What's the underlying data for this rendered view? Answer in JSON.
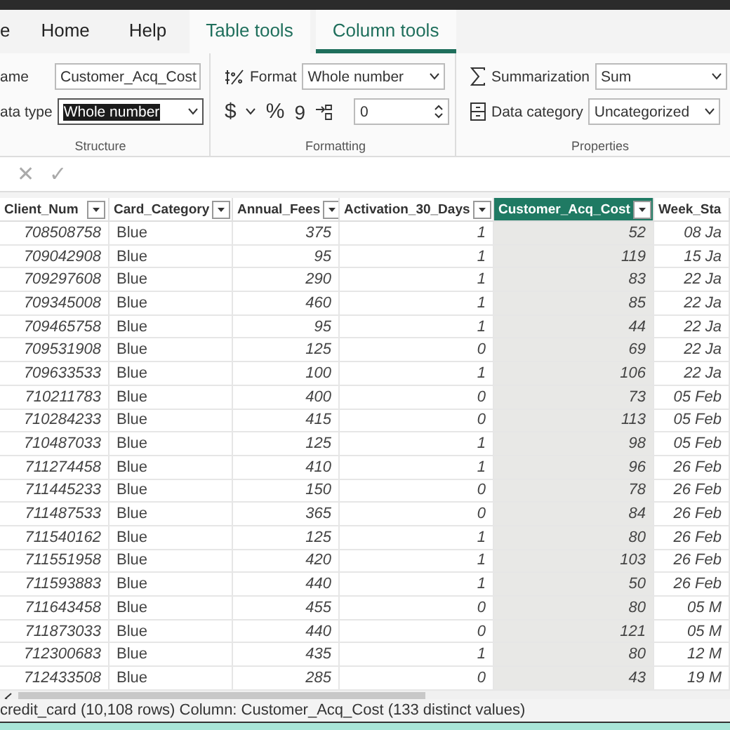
{
  "ribbon_tabs": [
    {
      "label": "e",
      "selected": false
    },
    {
      "label": "Home",
      "selected": false
    },
    {
      "label": "Help",
      "selected": false
    },
    {
      "label": "Table tools",
      "selected": false
    },
    {
      "label": "Column tools",
      "selected": true
    }
  ],
  "structure": {
    "name_label": "ame",
    "name_value": "Customer_Acq_Cost",
    "data_type_label": "ata type",
    "data_type_value": "Whole number",
    "group_label": "Structure"
  },
  "formatting": {
    "format_label": "Format",
    "format_value": "Whole number",
    "currency": "$",
    "percent": "%",
    "comma": "9",
    "decimals_value": "0",
    "group_label": "Formatting"
  },
  "properties": {
    "summarization_label": "Summarization",
    "summarization_value": "Sum",
    "data_category_label": "Data category",
    "data_category_value": "Uncategorized",
    "group_label": "Properties"
  },
  "formula_bar": {
    "cancel": "✕",
    "commit": "✓"
  },
  "table": {
    "columns": [
      {
        "label": "Client_Num",
        "selected": false,
        "kind": "number"
      },
      {
        "label": "Card_Category",
        "selected": false,
        "kind": "text"
      },
      {
        "label": "Annual_Fees",
        "selected": false,
        "kind": "number"
      },
      {
        "label": "Activation_30_Days",
        "selected": false,
        "kind": "number"
      },
      {
        "label": "Customer_Acq_Cost",
        "selected": true,
        "kind": "number"
      },
      {
        "label": "Week_Sta",
        "selected": false,
        "kind": "number"
      }
    ],
    "rows": [
      [
        "708508758",
        "Blue",
        "375",
        "1",
        "52",
        "08 Ja"
      ],
      [
        "709042908",
        "Blue",
        "95",
        "1",
        "119",
        "15 Ja"
      ],
      [
        "709297608",
        "Blue",
        "290",
        "1",
        "83",
        "22 Ja"
      ],
      [
        "709345008",
        "Blue",
        "460",
        "1",
        "85",
        "22 Ja"
      ],
      [
        "709465758",
        "Blue",
        "95",
        "1",
        "44",
        "22 Ja"
      ],
      [
        "709531908",
        "Blue",
        "125",
        "0",
        "69",
        "22 Ja"
      ],
      [
        "709633533",
        "Blue",
        "100",
        "1",
        "106",
        "22 Ja"
      ],
      [
        "710211783",
        "Blue",
        "400",
        "0",
        "73",
        "05 Feb"
      ],
      [
        "710284233",
        "Blue",
        "415",
        "0",
        "113",
        "05 Feb"
      ],
      [
        "710487033",
        "Blue",
        "125",
        "1",
        "98",
        "05 Feb"
      ],
      [
        "711274458",
        "Blue",
        "410",
        "1",
        "96",
        "26 Feb"
      ],
      [
        "711445233",
        "Blue",
        "150",
        "0",
        "78",
        "26 Feb"
      ],
      [
        "711487533",
        "Blue",
        "365",
        "0",
        "84",
        "26 Feb"
      ],
      [
        "711540162",
        "Blue",
        "125",
        "1",
        "80",
        "26 Feb"
      ],
      [
        "711551958",
        "Blue",
        "420",
        "1",
        "103",
        "26 Feb"
      ],
      [
        "711593883",
        "Blue",
        "440",
        "1",
        "50",
        "26 Feb"
      ],
      [
        "711643458",
        "Blue",
        "455",
        "0",
        "80",
        "05 M"
      ],
      [
        "711873033",
        "Blue",
        "440",
        "0",
        "121",
        "05 M"
      ],
      [
        "712300683",
        "Blue",
        "435",
        "1",
        "80",
        "12 M"
      ],
      [
        "712433508",
        "Blue",
        "285",
        "0",
        "43",
        "19 M"
      ]
    ]
  },
  "status_bar": "credit_card (10,108 rows) Column: Customer_Acq_Cost (133 distinct values)"
}
